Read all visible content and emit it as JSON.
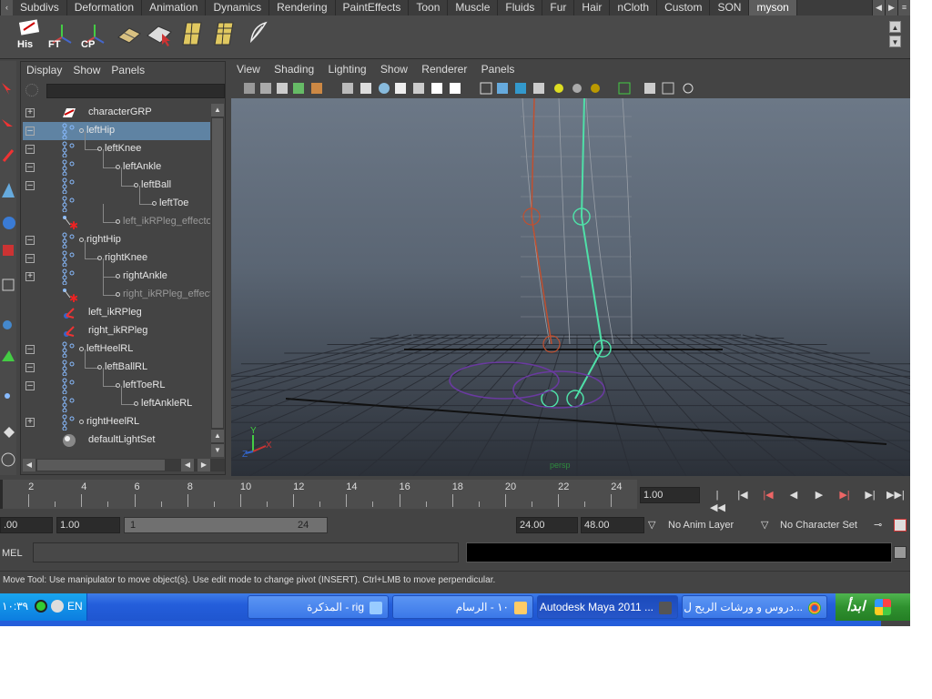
{
  "shelf_tabs": [
    "Subdivs",
    "Deformation",
    "Animation",
    "Dynamics",
    "Rendering",
    "PaintEffects",
    "Toon",
    "Muscle",
    "Fluids",
    "Fur",
    "Hair",
    "nCloth",
    "Custom",
    "SON",
    "myson"
  ],
  "shelf_active_tab": "myson",
  "shelf_buttons": [
    {
      "icon": "history-icon",
      "label": "His"
    },
    {
      "icon": "freeze-transform-icon",
      "label": "FT"
    },
    {
      "icon": "center-pivot-icon",
      "label": "CP"
    },
    {
      "icon": "plane-tool-icon",
      "label": ""
    },
    {
      "icon": "select-plane-icon",
      "label": ""
    },
    {
      "icon": "grid-plane-icon",
      "label": ""
    },
    {
      "icon": "mesh-plane-icon",
      "label": ""
    },
    {
      "icon": "feather-icon",
      "label": ""
    }
  ],
  "outliner": {
    "menus": [
      "Display",
      "Show",
      "Panels"
    ],
    "search_value": "",
    "items": [
      {
        "name": "characterGRP",
        "type": "group",
        "expander": "+",
        "depth": 0,
        "selected": false,
        "dim": false
      },
      {
        "name": "leftHip",
        "type": "joint",
        "expander": "-",
        "depth": 0,
        "selected": true,
        "dim": false
      },
      {
        "name": "leftKnee",
        "type": "joint",
        "expander": "-",
        "depth": 1,
        "selected": false,
        "dim": false
      },
      {
        "name": "leftAnkle",
        "type": "joint",
        "expander": "-",
        "depth": 2,
        "selected": false,
        "dim": false
      },
      {
        "name": "leftBall",
        "type": "joint",
        "expander": "-",
        "depth": 3,
        "selected": false,
        "dim": false
      },
      {
        "name": "leftToe",
        "type": "joint",
        "expander": "",
        "depth": 4,
        "selected": false,
        "dim": false
      },
      {
        "name": "left_ikRPleg_effector",
        "type": "effector",
        "expander": "",
        "depth": 2,
        "selected": false,
        "dim": true
      },
      {
        "name": "rightHip",
        "type": "joint",
        "expander": "-",
        "depth": 0,
        "selected": false,
        "dim": false
      },
      {
        "name": "rightKnee",
        "type": "joint",
        "expander": "-",
        "depth": 1,
        "selected": false,
        "dim": false
      },
      {
        "name": "rightAnkle",
        "type": "joint",
        "expander": "+",
        "depth": 2,
        "selected": false,
        "dim": false
      },
      {
        "name": "right_ikRPleg_effector",
        "type": "effector",
        "expander": "",
        "depth": 2,
        "selected": false,
        "dim": true
      },
      {
        "name": "left_ikRPleg",
        "type": "ikhandle",
        "expander": "",
        "depth": 0,
        "selected": false,
        "dim": false
      },
      {
        "name": "right_ikRPleg",
        "type": "ikhandle",
        "expander": "",
        "depth": 0,
        "selected": false,
        "dim": false
      },
      {
        "name": "leftHeelRL",
        "type": "joint",
        "expander": "-",
        "depth": 0,
        "selected": false,
        "dim": false
      },
      {
        "name": "leftBallRL",
        "type": "joint",
        "expander": "-",
        "depth": 1,
        "selected": false,
        "dim": false
      },
      {
        "name": "leftToeRL",
        "type": "joint",
        "expander": "-",
        "depth": 2,
        "selected": false,
        "dim": false
      },
      {
        "name": "leftAnkleRL",
        "type": "joint",
        "expander": "",
        "depth": 3,
        "selected": false,
        "dim": false
      },
      {
        "name": "rightHeelRL",
        "type": "joint",
        "expander": "+",
        "depth": 0,
        "selected": false,
        "dim": false
      },
      {
        "name": "defaultLightSet",
        "type": "set",
        "expander": "",
        "depth": 0,
        "selected": false,
        "dim": false
      }
    ]
  },
  "viewport": {
    "menus": [
      "View",
      "Shading",
      "Lighting",
      "Show",
      "Renderer",
      "Panels"
    ],
    "camera_label": "persp",
    "axis_labels": [
      "Y",
      "X",
      "Z"
    ]
  },
  "timeslider": {
    "tick_labels": [
      "2",
      "4",
      "6",
      "8",
      "10",
      "12",
      "14",
      "16",
      "18",
      "20",
      "22",
      "24"
    ],
    "current_frame": "1.00"
  },
  "range": {
    "start_time": ".00",
    "playback_start": "1.00",
    "range_start": "1",
    "range_end": "24",
    "playback_end": "24.00",
    "end_time": "48.00",
    "anim_layer": "No Anim Layer",
    "character_set": "No Character Set"
  },
  "command": {
    "label": "MEL",
    "input_value": "",
    "result_value": ""
  },
  "help_line": "Move Tool: Use manipulator to move object(s). Use edit mode to change pivot (INSERT).  Ctrl+LMB to move perpendicular.",
  "taskbar": {
    "clock": "١٠:٣٩",
    "language": "EN",
    "tasks": [
      {
        "label": "المذكرة - rig",
        "icon": "notepad-icon",
        "active": false
      },
      {
        "label": "١٠ - الرسام",
        "icon": "paint-icon",
        "active": false
      },
      {
        "label": "Autodesk Maya 2011 ...",
        "icon": "maya-icon",
        "active": true
      },
      {
        "label": "دروس و ورشات الريح ل...",
        "icon": "chrome-icon",
        "active": false
      }
    ],
    "start_label": "ابدأ"
  },
  "colors": {
    "maya_bg": "#444444",
    "selection": "#5f83a3",
    "skeleton_active": "#4fe0a8",
    "skeleton_inactive": "#c05030",
    "taskbar_blue": "#245edb",
    "start_green": "#2f912f"
  }
}
